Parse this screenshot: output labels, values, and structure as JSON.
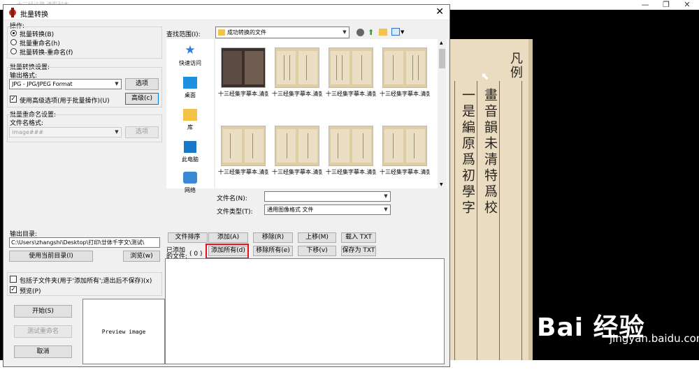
{
  "background": {
    "title_text": "十三经注疏 清影刊本 ...",
    "win_controls": [
      "—",
      "❐",
      "✕"
    ],
    "book_head": "凡例",
    "book_columns": [
      "一是編原爲初學字",
      "畫音韻未清特爲校"
    ],
    "watermark_brand": "Bai 经验",
    "watermark_url": "jingyan.baidu.com"
  },
  "dialog": {
    "title": "批量转换",
    "close": "✕",
    "operation": {
      "label": "操作:",
      "options": [
        "批量转换(B)",
        "批量重命名(h)",
        "批量转换-重命名(f)"
      ],
      "selected_index": 0
    },
    "convert_settings": {
      "label": "批量转换设置:",
      "format_label": "输出格式:",
      "format_value": "JPG - JPG/JPEG Format",
      "options_button": "选项",
      "advanced_checkbox": "使用高级选项(用于批量操作)(U)",
      "advanced_checked": true,
      "advanced_button": "高级(c)"
    },
    "rename_settings": {
      "label": "批量重命名设置:",
      "name_label": "文件名格式:",
      "name_value": "image###",
      "options_button": "选项"
    },
    "output": {
      "label": "输出目录:",
      "path": "C:\\Users\\zhangshi\\Desktop\\打印\\廿体千字文\\测试\\",
      "use_current_button": "使用当前目录(l)",
      "browse_button": "浏览(w)"
    },
    "include_subfolders": {
      "label": "包括子文件夹(用于'添加所有';退出后不保存)(x)",
      "checked": false
    },
    "preview": {
      "label": "预览(P)",
      "checked": true
    },
    "actions": {
      "start": "开始(S)",
      "test_rename": "测试重命名",
      "cancel": "取消"
    },
    "preview_image_text": "Preview image",
    "file_browser": {
      "lookin_label": "查找范围(I):",
      "lookin_value": "成功转换的文件",
      "places": [
        "快速访问",
        "桌面",
        "库",
        "此电脑",
        "网络"
      ],
      "thumbnails": [
        "十三经集字摹本.清彭玉雯纂刊.万青...",
        "十三经集字摹本.清彭玉雯纂刊.万青...",
        "十三经集字摹本.清彭玉雯纂刊.万青...",
        "十三经集字摹本.清彭玉雯纂刊.万青...",
        "十三经集字摹本.清彭玉雯纂刊.万青...",
        "十三经集字摹本.清彭玉雯纂刊.万青...",
        "十三经集字摹本.清彭玉雯纂刊.万青...",
        "十三经集字摹本.清彭玉雯纂刊.万青..."
      ],
      "filename_label": "文件名(N):",
      "filename_value": "",
      "filetype_label": "文件类型(T):",
      "filetype_value": "通用图像格式 文件"
    },
    "list_buttons": {
      "sort": "文件排序",
      "add": "添加(A)",
      "remove": "移除(R)",
      "move_up": "上移(M)",
      "load_txt": "载入 TXT",
      "add_all": "添加所有(d)",
      "remove_all": "移除所有(e)",
      "move_down": "下移(v)",
      "save_txt": "保存为 TXT"
    },
    "added_files_label_1": "已添加",
    "added_files_label_2": "的文件:",
    "added_files_count": "( 0 )"
  }
}
